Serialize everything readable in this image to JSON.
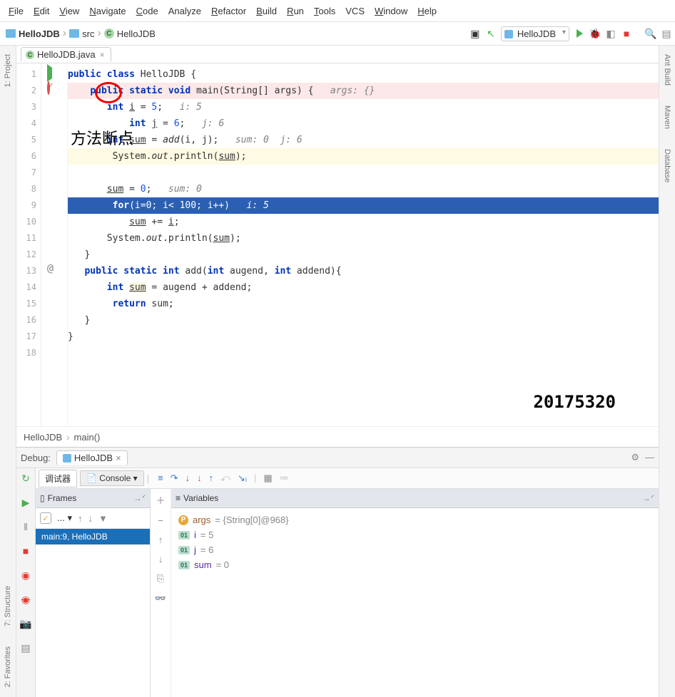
{
  "menu": [
    "File",
    "Edit",
    "View",
    "Navigate",
    "Code",
    "Analyze",
    "Refactor",
    "Build",
    "Run",
    "Tools",
    "VCS",
    "Window",
    "Help"
  ],
  "menu_mnemonic": [
    "F",
    "E",
    "V",
    "N",
    "C",
    "",
    "R",
    "B",
    "R",
    "T",
    "",
    "W",
    "H"
  ],
  "breadcrumb": {
    "project": "HelloJDB",
    "src": "src",
    "class": "HelloJDB"
  },
  "runConfig": "HelloJDB",
  "tab": {
    "name": "HelloJDB.java"
  },
  "leftTabs": [
    "1: Project"
  ],
  "rightTabs": [
    "Ant Build",
    "Maven",
    "Database"
  ],
  "bottomLeft": [
    "7: Structure",
    "2: Favorites"
  ],
  "code": {
    "lines": [
      {
        "n": 1,
        "hl": "",
        "html": "<span class='kw'>public class</span> HelloJDB {",
        "gutter": "run"
      },
      {
        "n": 2,
        "hl": "hl-pink",
        "html": "    <span class='kw'>public static void</span> main(String[] args) {   <span class='com'>args: {}</span>",
        "gutter": "method-bp"
      },
      {
        "n": 3,
        "hl": "",
        "html": "       <span class='kw'>int</span> <span class='ul'>i</span> = <span class='lit'>5</span>;   <span class='com'>i: 5</span>"
      },
      {
        "n": 4,
        "hl": "",
        "html": "           <span class='kw'>int</span> <span class='ul'>j</span> = <span class='lit'>6</span>;   <span class='com'>j: 6</span>"
      },
      {
        "n": 5,
        "hl": "",
        "html": "       <span class='kw'>int</span> <span class='ul'>sum</span> = <span class='fn'>add</span>(i, j);   <span class='com'>sum: 0  j: 6</span>"
      },
      {
        "n": 6,
        "hl": "hl-yel2",
        "html": "        System.<span class='fn'>out</span>.println(<span class='ul'>sum</span>);"
      },
      {
        "n": 7,
        "hl": "",
        "html": ""
      },
      {
        "n": 8,
        "hl": "",
        "html": "       <span class='ul'>sum</span> = <span class='lit'>0</span>;   <span class='com'>sum: 0</span>"
      },
      {
        "n": 9,
        "hl": "hl-blue",
        "html": "        <span class='kw'>for</span>(i=<span class='lit'>0</span>; i&lt; <span class='lit'>100</span>; i++)   <span class='com'>i: 5</span>",
        "gutter": "line-bp"
      },
      {
        "n": 10,
        "hl": "",
        "html": "           <span class='ul'>sum</span> += <span class='ul'>i</span>;"
      },
      {
        "n": 11,
        "hl": "",
        "html": "       System.<span class='fn'>out</span>.println(<span class='ul'>sum</span>);"
      },
      {
        "n": 12,
        "hl": "",
        "html": "   }"
      },
      {
        "n": 13,
        "hl": "",
        "html": "   <span class='kw'>public static int</span> add(<span class='kw'>int</span> augend, <span class='kw'>int</span> addend){",
        "gutter": "at"
      },
      {
        "n": 14,
        "hl": "",
        "html": "       <span class='kw'>int</span> <span class='ul' style='background:#fffae3'>sum</span> = augend + addend;"
      },
      {
        "n": 15,
        "hl": "",
        "html": "        <span class='kw'>return</span> sum;"
      },
      {
        "n": 16,
        "hl": "",
        "html": "   }"
      },
      {
        "n": 17,
        "hl": "",
        "html": "}"
      },
      {
        "n": 18,
        "hl": "",
        "html": ""
      }
    ]
  },
  "codeCrumb": {
    "a": "HelloJDB",
    "b": "main()"
  },
  "annotationLabel": "方法断点",
  "watermark": "20175320",
  "debug": {
    "title": "Debug:",
    "config": "HelloJDB",
    "subtabs": {
      "debugger": "调试器",
      "console": "Console"
    },
    "framesLabel": "Frames",
    "varsLabel": "Variables",
    "frame": "main:9, HelloJDB",
    "vars": [
      {
        "kind": "p",
        "name": "args",
        "suffix": " = {String[0]@968}"
      },
      {
        "kind": "i",
        "name": "i",
        "suffix": " = 5"
      },
      {
        "kind": "i",
        "name": "j",
        "suffix": " = 6"
      },
      {
        "kind": "i",
        "name": "sum",
        "suffix": " = 0"
      }
    ]
  }
}
